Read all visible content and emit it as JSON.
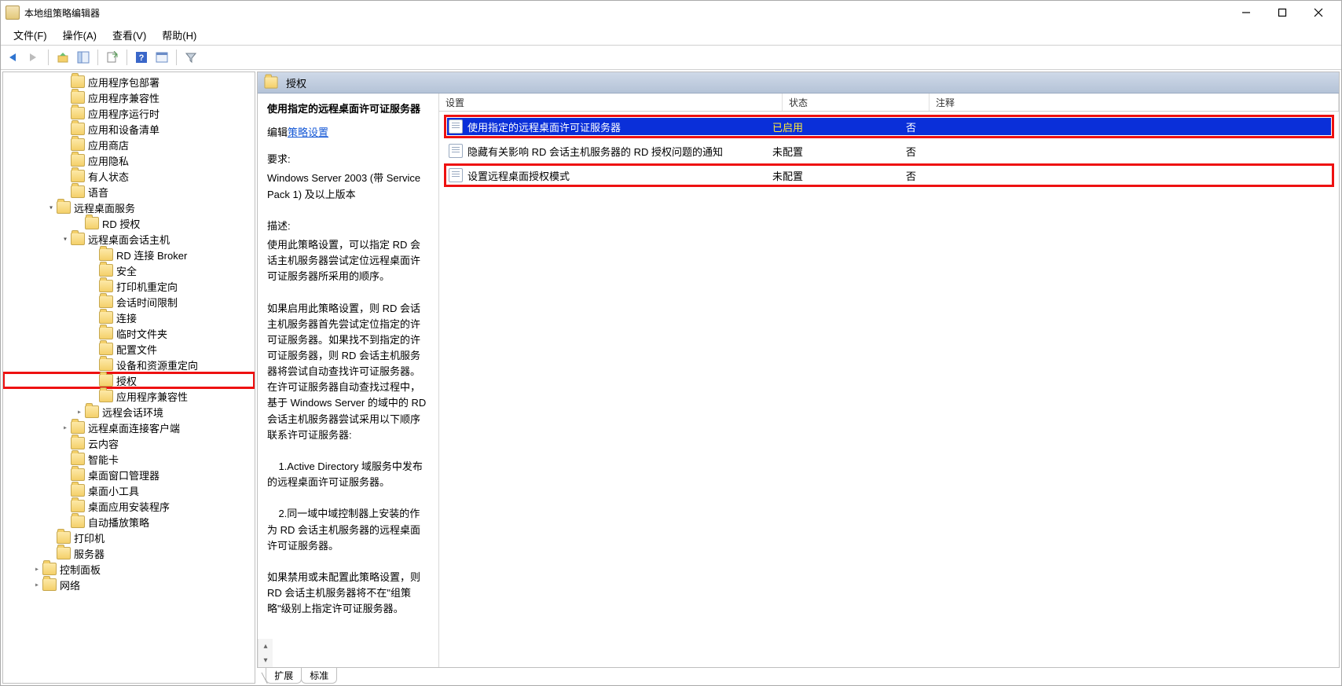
{
  "window": {
    "title": "本地组策略编辑器"
  },
  "menu": {
    "file": "文件(F)",
    "action": "操作(A)",
    "view": "查看(V)",
    "help": "帮助(H)"
  },
  "tree": {
    "items": [
      {
        "indent": 4,
        "expander": "none",
        "label": "应用程序包部署"
      },
      {
        "indent": 4,
        "expander": "none",
        "label": "应用程序兼容性"
      },
      {
        "indent": 4,
        "expander": "none",
        "label": "应用程序运行时"
      },
      {
        "indent": 4,
        "expander": "none",
        "label": "应用和设备清单"
      },
      {
        "indent": 4,
        "expander": "none",
        "label": "应用商店"
      },
      {
        "indent": 4,
        "expander": "none",
        "label": "应用隐私"
      },
      {
        "indent": 4,
        "expander": "none",
        "label": "有人状态"
      },
      {
        "indent": 4,
        "expander": "none",
        "label": "语音"
      },
      {
        "indent": 3,
        "expander": "open",
        "label": "远程桌面服务"
      },
      {
        "indent": 5,
        "expander": "none",
        "label": "RD 授权"
      },
      {
        "indent": 4,
        "expander": "open",
        "label": "远程桌面会话主机"
      },
      {
        "indent": 6,
        "expander": "none",
        "label": "RD 连接 Broker"
      },
      {
        "indent": 6,
        "expander": "none",
        "label": "安全"
      },
      {
        "indent": 6,
        "expander": "none",
        "label": "打印机重定向"
      },
      {
        "indent": 6,
        "expander": "none",
        "label": "会话时间限制"
      },
      {
        "indent": 6,
        "expander": "none",
        "label": "连接"
      },
      {
        "indent": 6,
        "expander": "none",
        "label": "临时文件夹"
      },
      {
        "indent": 6,
        "expander": "none",
        "label": "配置文件"
      },
      {
        "indent": 6,
        "expander": "none",
        "label": "设备和资源重定向"
      },
      {
        "indent": 6,
        "expander": "none",
        "label": "授权",
        "highlight": true
      },
      {
        "indent": 6,
        "expander": "none",
        "label": "应用程序兼容性"
      },
      {
        "indent": 5,
        "expander": "closed",
        "label": "远程会话环境"
      },
      {
        "indent": 4,
        "expander": "closed",
        "label": "远程桌面连接客户端"
      },
      {
        "indent": 4,
        "expander": "none",
        "label": "云内容"
      },
      {
        "indent": 4,
        "expander": "none",
        "label": "智能卡"
      },
      {
        "indent": 4,
        "expander": "none",
        "label": "桌面窗口管理器"
      },
      {
        "indent": 4,
        "expander": "none",
        "label": "桌面小工具"
      },
      {
        "indent": 4,
        "expander": "none",
        "label": "桌面应用安装程序"
      },
      {
        "indent": 4,
        "expander": "none",
        "label": "自动播放策略"
      },
      {
        "indent": 3,
        "expander": "none",
        "label": "打印机"
      },
      {
        "indent": 3,
        "expander": "none",
        "label": "服务器"
      },
      {
        "indent": 2,
        "expander": "closed",
        "label": "控制面板"
      },
      {
        "indent": 2,
        "expander": "closed",
        "label": "网络"
      }
    ]
  },
  "header": {
    "title": "授权"
  },
  "description": {
    "title": "使用指定的远程桌面许可证服务器",
    "edit_label": "编辑",
    "edit_link": "策略设置",
    "req_label": "要求:",
    "req_text": "Windows Server 2003 (带 Service Pack 1) 及以上版本",
    "desc_label": "描述:",
    "body": "使用此策略设置，可以指定 RD 会话主机服务器尝试定位远程桌面许可证服务器所采用的顺序。\n\n如果启用此策略设置，则 RD 会话主机服务器首先尝试定位指定的许可证服务器。如果找不到指定的许可证服务器，则 RD 会话主机服务器将尝试自动查找许可证服务器。在许可证服务器自动查找过程中，基于 Windows Server 的域中的 RD 会话主机服务器尝试采用以下顺序联系许可证服务器:\n\n    1.Active Directory 域服务中发布的远程桌面许可证服务器。\n\n    2.同一域中域控制器上安装的作为 RD 会话主机服务器的远程桌面许可证服务器。\n\n如果禁用或未配置此策略设置，则 RD 会话主机服务器将不在\"组策略\"级别上指定许可证服务器。"
  },
  "columns": {
    "setting": "设置",
    "state": "状态",
    "comment": "注释"
  },
  "rows": [
    {
      "setting": "使用指定的远程桌面许可证服务器",
      "state": "已启用",
      "comment": "否",
      "selected": true,
      "highlight": true
    },
    {
      "setting": "隐藏有关影响 RD 会话主机服务器的 RD 授权问题的通知",
      "state": "未配置",
      "comment": "否",
      "selected": false,
      "highlight": false
    },
    {
      "setting": "设置远程桌面授权模式",
      "state": "未配置",
      "comment": "否",
      "selected": false,
      "highlight": true
    }
  ],
  "tabs": {
    "extended": "扩展",
    "standard": "标准"
  }
}
